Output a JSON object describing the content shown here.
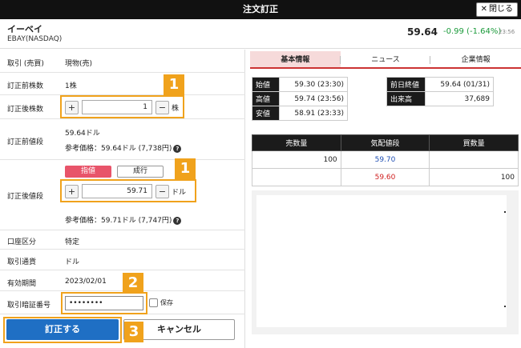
{
  "window": {
    "title": "注文訂正",
    "close_label": "閉じる"
  },
  "stock": {
    "name": "イーベイ",
    "exchange": "EBAY(NASDAQ)",
    "price": "59.64",
    "change": "-0.99 (-1.64%)",
    "time": "23:56",
    "change_color": "#1a9a3a"
  },
  "form": {
    "trade_type": {
      "label": "取引 (売買)",
      "value": "現物(売)"
    },
    "prev_qty": {
      "label": "訂正前株数",
      "value": "1株"
    },
    "new_qty": {
      "label": "訂正後株数",
      "value": "1",
      "unit": "株",
      "minus": "−",
      "plus": "+"
    },
    "prev_price": {
      "label": "訂正前値段",
      "value": "59.64ドル",
      "ref": "参考価格：59.64ドル (7,738円)"
    },
    "order_type": {
      "limit_label": "指値",
      "market_label": "成行",
      "selected": "指値",
      "selected_color": "#e8546a"
    },
    "new_price": {
      "label": "訂正後値段",
      "value": "59.71",
      "unit": "ドル",
      "minus": "−",
      "plus": "+",
      "ref": "参考価格：59.71ドル (7,747円)"
    },
    "account": {
      "label": "口座区分",
      "value": "特定"
    },
    "currency": {
      "label": "取引通貨",
      "value": "ドル"
    },
    "expiry": {
      "label": "有効期間",
      "value": "2023/02/01"
    },
    "pin": {
      "label": "取引暗証番号",
      "value": "••••••••",
      "save_label": "保存"
    },
    "submit_label": "訂正する",
    "cancel_label": "キャンセル"
  },
  "annotations": {
    "badge1": "1",
    "badge2": "2",
    "badge3": "3",
    "color": "#f0a21c"
  },
  "panel": {
    "tabs": [
      {
        "label": "基本情報"
      },
      {
        "label": "ニュース"
      },
      {
        "label": "企業情報"
      }
    ],
    "quote_left": [
      {
        "label": "始値",
        "value": "59.30 (23:30)"
      },
      {
        "label": "高値",
        "value": "59.74 (23:56)"
      },
      {
        "label": "安値",
        "value": "58.91 (23:33)"
      }
    ],
    "quote_right": [
      {
        "label": "前日終値",
        "value": "59.64 (01/31)"
      },
      {
        "label": "出来高",
        "value": "37,689"
      }
    ],
    "board": {
      "headers": [
        "売数量",
        "気配値段",
        "買数量"
      ],
      "rows": [
        {
          "sell_qty": "100",
          "price": "59.70",
          "buy_qty": ""
        },
        {
          "sell_qty": "",
          "price": "59.60",
          "buy_qty": "100"
        }
      ]
    }
  }
}
